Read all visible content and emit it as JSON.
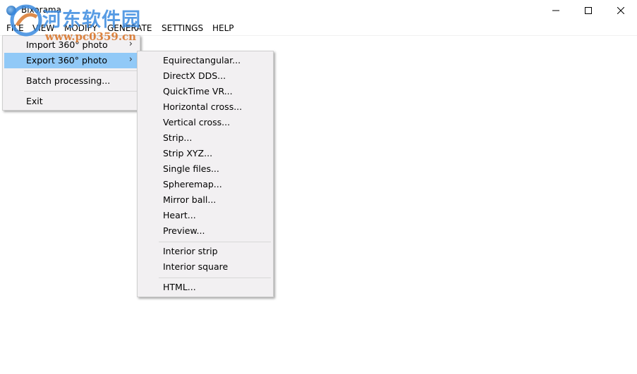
{
  "window": {
    "title": "Bixorama",
    "minimize_glyph": "minimize-icon",
    "maximize_glyph": "maximize-icon",
    "close_glyph": "close-icon"
  },
  "watermark": {
    "site_name": "河东软件园",
    "url": "www.pc0359.cn"
  },
  "menubar": {
    "items": [
      "FILE",
      "VIEW",
      "MODIFY",
      "GENERATE",
      "SETTINGS",
      "HELP"
    ]
  },
  "file_menu": {
    "items": [
      {
        "label": "Import 360° photo",
        "has_submenu": true
      },
      {
        "label": "Export 360° photo",
        "has_submenu": true,
        "highlighted": true
      },
      {
        "label": "Batch processing...",
        "has_submenu": false
      },
      {
        "label": "Exit",
        "has_submenu": false
      }
    ],
    "arrow": "›"
  },
  "export_submenu": {
    "items": [
      "Equirectangular...",
      "DirectX DDS...",
      "QuickTime VR...",
      "Horizontal cross...",
      "Vertical cross...",
      "Strip...",
      "Strip XYZ...",
      "Single files...",
      "Spheremap...",
      "Mirror ball...",
      "Heart...",
      "Preview...",
      "Interior strip",
      "Interior square",
      "HTML..."
    ]
  },
  "colors": {
    "highlight": "#91c9f7",
    "menu_background": "#f2f0f2",
    "watermark_blue": "#3c8be0",
    "watermark_orange": "#d9772c"
  }
}
